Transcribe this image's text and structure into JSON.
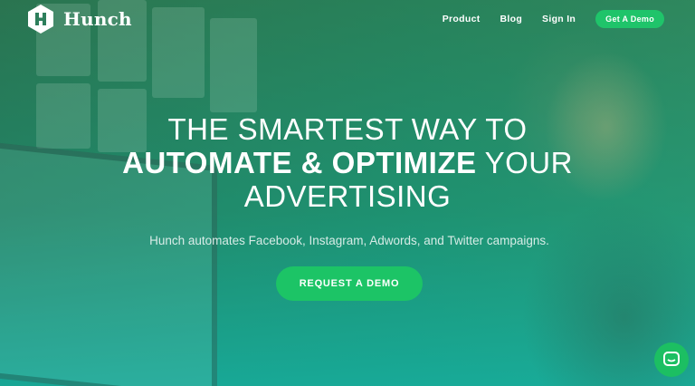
{
  "brand": {
    "name": "Hunch",
    "logo_icon": "hexagon-h-logo-icon"
  },
  "nav": {
    "links": [
      "Product",
      "Blog",
      "Sign In"
    ],
    "cta_label": "Get A Demo"
  },
  "hero": {
    "headline_line1": "THE SMARTEST WAY TO",
    "headline_line2_bold": "AUTOMATE & OPTIMIZE",
    "headline_line2_light": " YOUR",
    "headline_line3": "ADVERTISING",
    "subhead": "Hunch automates Facebook, Instagram, Adwords, and Twitter campaigns.",
    "cta_label": "REQUEST A DEMO"
  },
  "chat_widget": {
    "icon": "chat-bubble-icon"
  },
  "colors": {
    "accent_green": "#1cc466",
    "overlay_teal": "#14af9f"
  }
}
